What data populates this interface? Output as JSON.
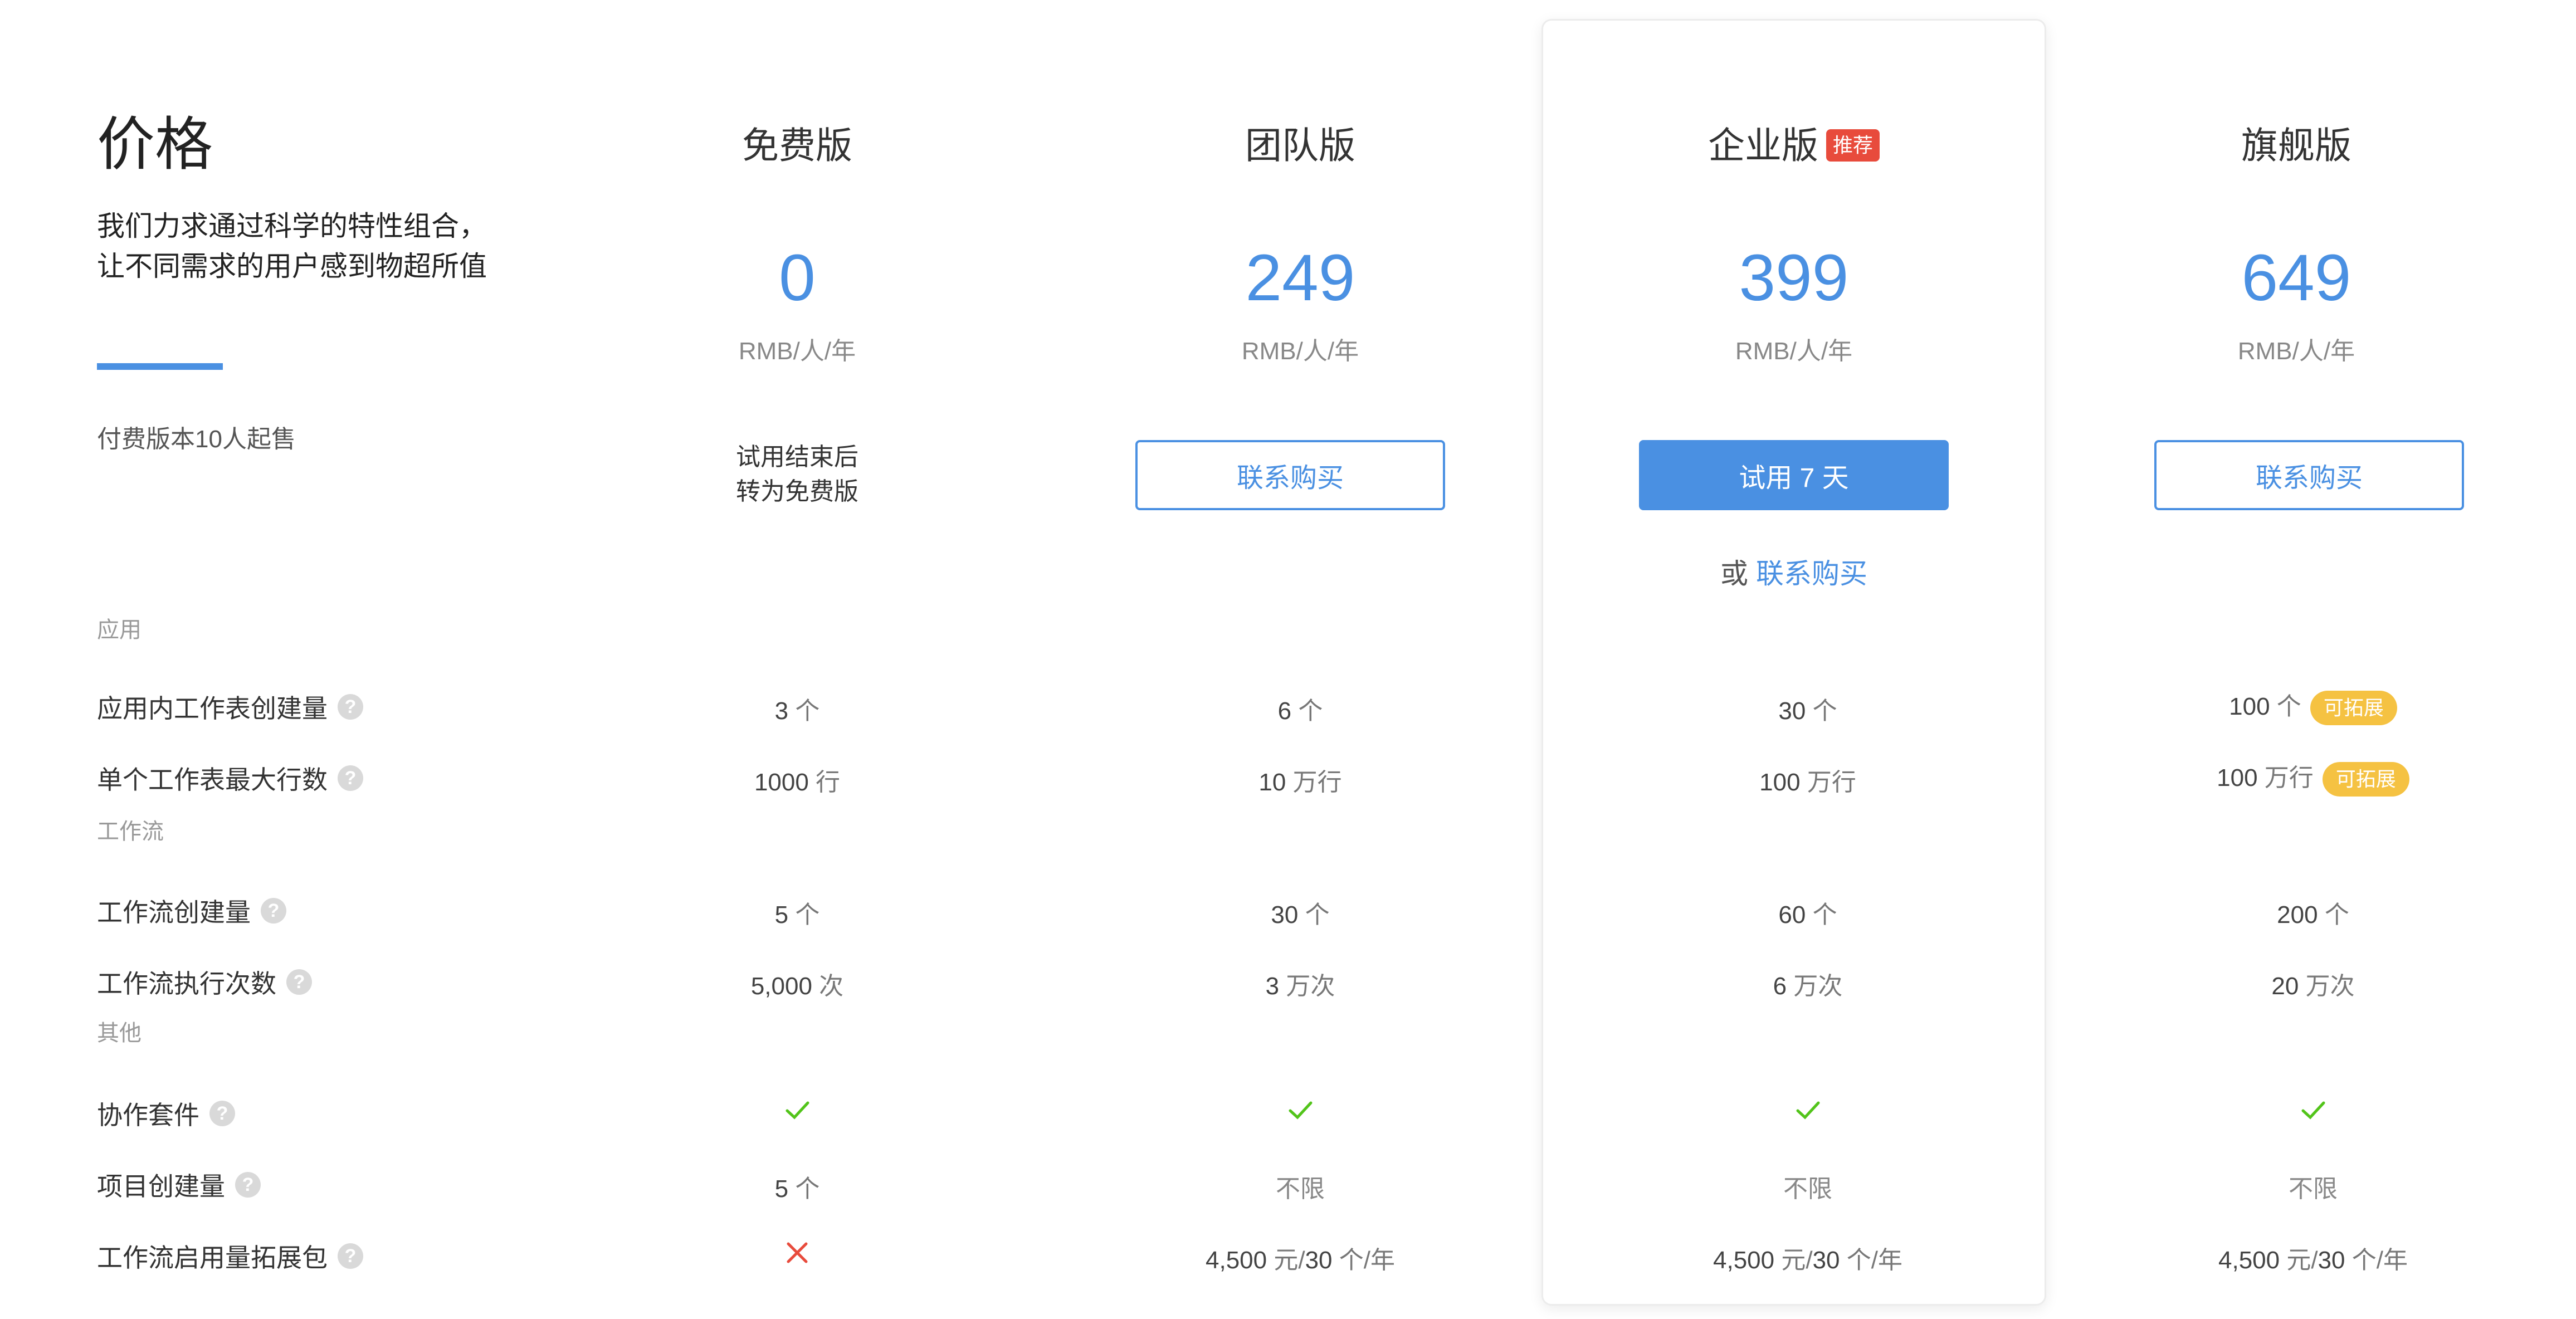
{
  "intro": {
    "title": "价格",
    "subtitle_line1": "我们力求通过科学的特性组合，",
    "subtitle_line2": "让不同需求的用户感到物超所值",
    "note": "付费版本10人起售"
  },
  "colors": {
    "accent": "#4a90e2",
    "recommend": "#e84b3c",
    "expandable": "#f5c242",
    "check": "#52c41a",
    "cross": "#e84b3c"
  },
  "plans": [
    {
      "name": "免费版",
      "price": "0",
      "unit": "RMB/人/年",
      "cta_line1": "试用结束后",
      "cta_line2": "转为免费版"
    },
    {
      "name": "团队版",
      "price": "249",
      "unit": "RMB/人/年",
      "cta": "联系购买"
    },
    {
      "name": "企业版",
      "badge": "推荐",
      "price": "399",
      "unit": "RMB/人/年",
      "cta": "试用 7 天",
      "alt_prefix": "或",
      "alt_link": "联系购买"
    },
    {
      "name": "旗舰版",
      "price": "649",
      "unit": "RMB/人/年",
      "cta": "联系购买"
    }
  ],
  "sections": {
    "app": "应用",
    "workflow": "工作流",
    "other": "其他"
  },
  "features": {
    "sheets": {
      "label": "应用内工作表创建量",
      "values": [
        {
          "n": "3",
          "u": " 个"
        },
        {
          "n": "6",
          "u": " 个"
        },
        {
          "n": "30",
          "u": " 个"
        },
        {
          "n": "100",
          "u": " 个",
          "badge": "可拓展"
        }
      ]
    },
    "rows": {
      "label": "单个工作表最大行数",
      "values": [
        {
          "n": "1000",
          "u": " 行"
        },
        {
          "n": "10",
          "u": " 万行"
        },
        {
          "n": "100",
          "u": " 万行"
        },
        {
          "n": "100",
          "u": " 万行",
          "badge": "可拓展"
        }
      ]
    },
    "wf_count": {
      "label": "工作流创建量",
      "values": [
        {
          "n": "5",
          "u": " 个"
        },
        {
          "n": "30",
          "u": " 个"
        },
        {
          "n": "60",
          "u": " 个"
        },
        {
          "n": "200",
          "u": " 个"
        }
      ]
    },
    "wf_runs": {
      "label": "工作流执行次数",
      "values": [
        {
          "n": "5,000",
          "u": " 次"
        },
        {
          "n": "3",
          "u": " 万次"
        },
        {
          "n": "6",
          "u": " 万次"
        },
        {
          "n": "20",
          "u": " 万次"
        }
      ]
    },
    "collab": {
      "label": "协作套件",
      "values": [
        "check",
        "check",
        "check",
        "check"
      ]
    },
    "projects": {
      "label": "项目创建量",
      "values": [
        {
          "n": "5",
          "u": " 个"
        },
        {
          "t": "不限"
        },
        {
          "t": "不限"
        },
        {
          "t": "不限"
        }
      ]
    },
    "wf_pack": {
      "label": "工作流启用量拓展包",
      "values": [
        "cross",
        {
          "a": "4,500",
          "b": " 元/",
          "c": "30",
          "d": " 个/年"
        },
        {
          "a": "4,500",
          "b": " 元/",
          "c": "30",
          "d": " 个/年"
        },
        {
          "a": "4,500",
          "b": " 元/",
          "c": "30",
          "d": " 个/年"
        }
      ]
    }
  }
}
